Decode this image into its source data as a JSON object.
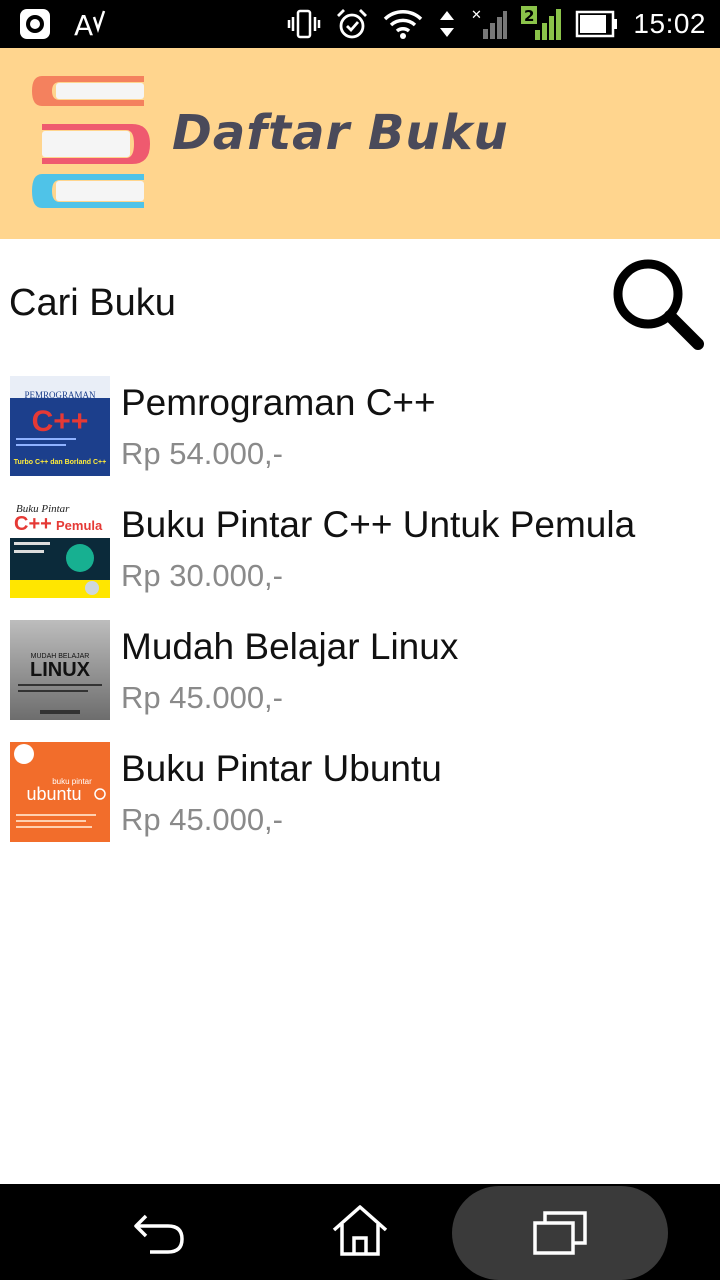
{
  "status_bar": {
    "time": "15:02",
    "left_icons": [
      "screen-record-icon",
      "text-spell-icon"
    ],
    "right_icons": [
      "vibrate-icon",
      "alarm-icon",
      "wifi-icon",
      "data-arrows-icon",
      "signal-sim1-icon",
      "signal-sim2-icon",
      "battery-icon"
    ],
    "sim2_label": "2"
  },
  "header": {
    "title": "Daftar Buku",
    "colors": {
      "background": "#ffd58e",
      "title": "#4a4a5a"
    }
  },
  "search": {
    "label": "Cari Buku",
    "icon": "search-icon"
  },
  "books": [
    {
      "title": "Pemrograman C++",
      "price": "Rp 54.000,-",
      "cover": {
        "theme": "blue",
        "text_top": "PEMROGRAMAN",
        "text_main": "C++",
        "text_bottom": "Turbo C++ dan Borland C++"
      }
    },
    {
      "title": "Buku Pintar C++ Untuk Pemula",
      "price": "Rp 30.000,-",
      "cover": {
        "theme": "white-green",
        "text_top": "Buku Pintar",
        "text_main": "C++",
        "text_bottom": "Pemula"
      }
    },
    {
      "title": "Mudah Belajar Linux",
      "price": "Rp 45.000,-",
      "cover": {
        "theme": "silver",
        "text_top": "MUDAH BELAJAR",
        "text_main": "LINUX",
        "text_bottom": ""
      }
    },
    {
      "title": "Buku Pintar Ubuntu",
      "price": "Rp 45.000,-",
      "cover": {
        "theme": "orange",
        "text_top": "buku pintar",
        "text_main": "ubuntu",
        "text_bottom": ""
      }
    }
  ],
  "nav_bar": {
    "buttons": [
      "back-icon",
      "home-icon",
      "recents-icon"
    ]
  }
}
